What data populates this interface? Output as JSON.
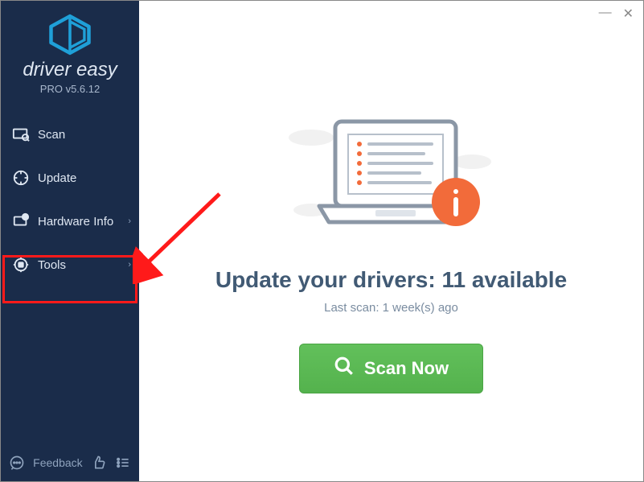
{
  "brand": "driver easy",
  "version": "PRO v5.6.12",
  "sidebar": {
    "items": [
      {
        "label": "Scan"
      },
      {
        "label": "Update"
      },
      {
        "label": "Hardware Info"
      },
      {
        "label": "Tools"
      }
    ],
    "feedback_label": "Feedback"
  },
  "main": {
    "headline": "Update your drivers: 11 available",
    "subline": "Last scan: 1 week(s) ago",
    "scan_button": "Scan Now"
  },
  "window": {
    "minimize": "—",
    "close": "✕"
  }
}
